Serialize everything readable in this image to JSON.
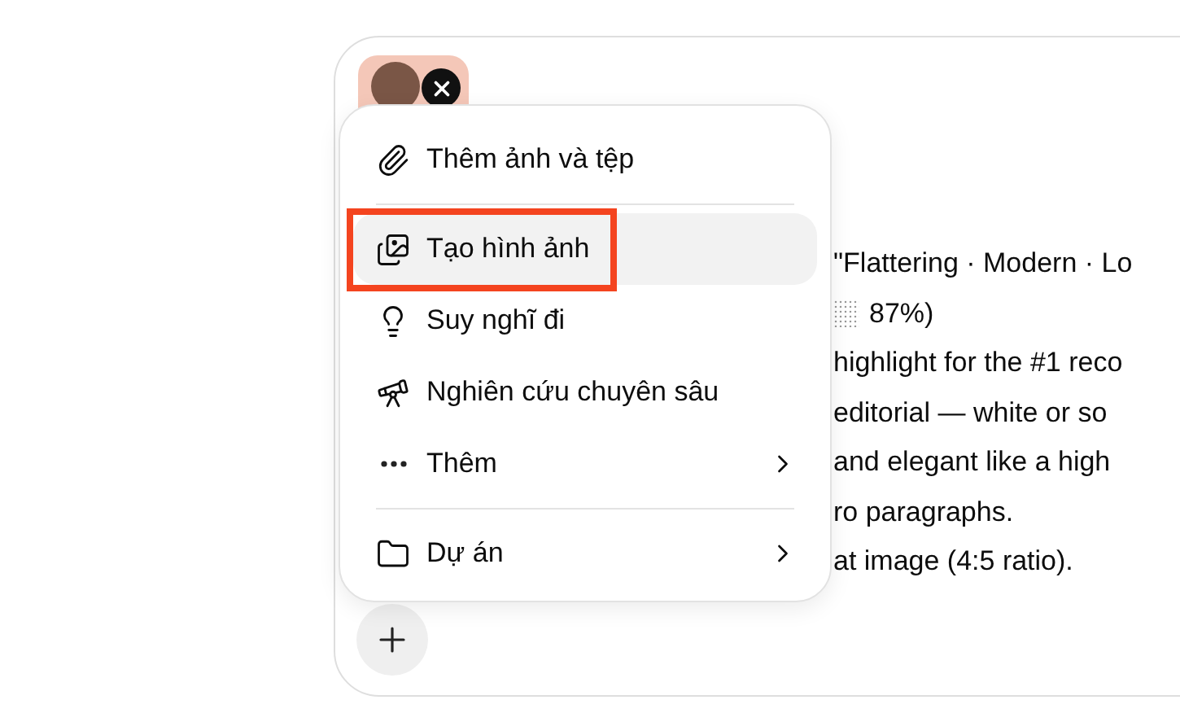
{
  "attachment": {
    "removable": true
  },
  "message_lines": [
    "\"Flattering · Modern · Lo",
    "87%)",
    "highlight for the #1 reco",
    "editorial — white or so",
    "and elegant like a high",
    "ro paragraphs.",
    "at image (4:5 ratio)."
  ],
  "menu": [
    {
      "kind": "item",
      "label": "Thêm ảnh và tệp",
      "selected": false,
      "submenu": false,
      "annotated": false
    },
    {
      "kind": "divider"
    },
    {
      "kind": "item",
      "label": "Tạo hình ảnh",
      "selected": true,
      "submenu": false,
      "annotated": true
    },
    {
      "kind": "item",
      "label": "Suy nghĩ đi",
      "selected": false,
      "submenu": false,
      "annotated": false
    },
    {
      "kind": "item",
      "label": "Nghiên cứu chuyên sâu",
      "selected": false,
      "submenu": false,
      "annotated": false
    },
    {
      "kind": "item",
      "label": "Thêm",
      "selected": false,
      "submenu": true,
      "annotated": false
    },
    {
      "kind": "divider"
    },
    {
      "kind": "item",
      "label": "Dự án",
      "selected": false,
      "submenu": true,
      "annotated": false
    }
  ]
}
